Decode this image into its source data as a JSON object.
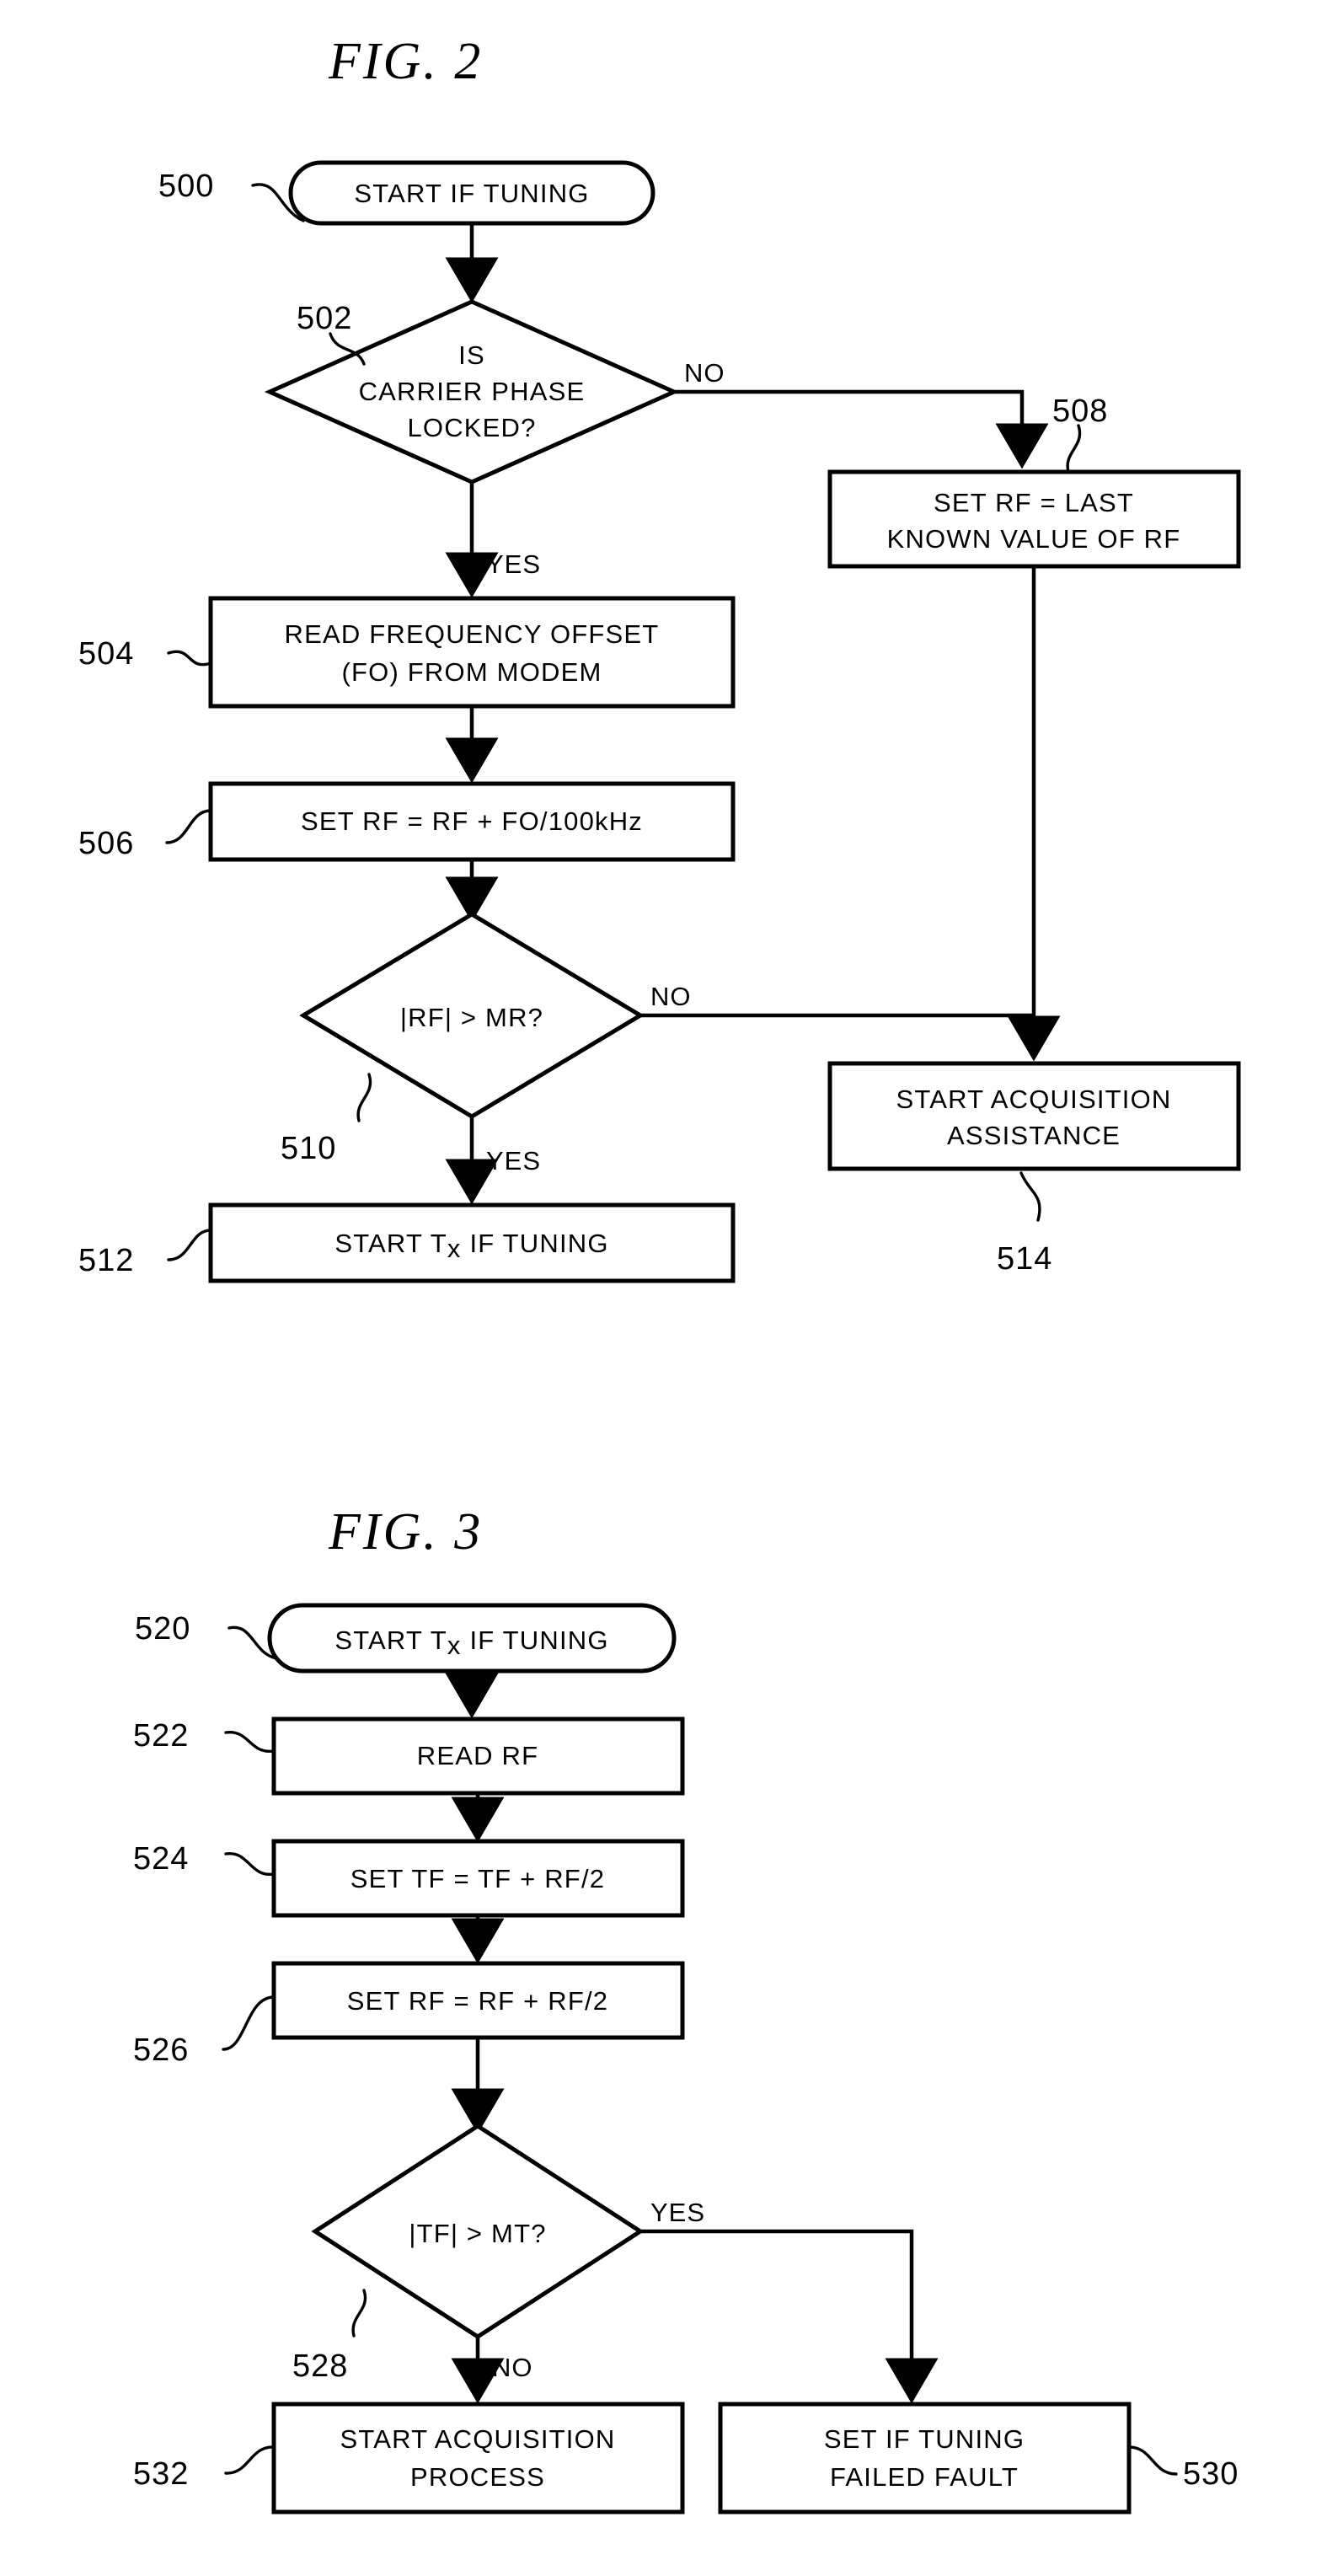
{
  "document": {
    "kind": "patent-flowchart-sheet",
    "ink_color": "#000000",
    "paper_color": "#ffffff"
  },
  "figures": [
    {
      "id": "fig2",
      "title": "FIG.  2",
      "nodes": [
        {
          "ref": "500",
          "shape": "terminator",
          "lines": [
            "START IF TUNING"
          ]
        },
        {
          "ref": "502",
          "shape": "decision",
          "lines": [
            "IS",
            "CARRIER PHASE",
            "LOCKED?"
          ]
        },
        {
          "ref": "504",
          "shape": "process",
          "lines": [
            "READ FREQUENCY OFFSET",
            "(FO) FROM MODEM"
          ]
        },
        {
          "ref": "506",
          "shape": "process",
          "lines": [
            "SET RF = RF + FO/100kHz"
          ]
        },
        {
          "ref": "508",
          "shape": "process",
          "lines": [
            "SET RF = LAST",
            "KNOWN VALUE OF RF"
          ]
        },
        {
          "ref": "510",
          "shape": "decision",
          "lines": [
            "|RF| > MR?"
          ]
        },
        {
          "ref": "512",
          "shape": "process",
          "lines": [
            "START Tx IF TUNING"
          ]
        },
        {
          "ref": "514",
          "shape": "process",
          "lines": [
            "START ACQUISITION",
            "ASSISTANCE"
          ]
        }
      ],
      "branch_labels": {
        "d502_no": "NO",
        "d502_yes": "YES",
        "d510_no": "NO",
        "d510_yes": "YES"
      }
    },
    {
      "id": "fig3",
      "title": "FIG.  3",
      "nodes": [
        {
          "ref": "520",
          "shape": "terminator",
          "lines": [
            "START Tx IF TUNING"
          ]
        },
        {
          "ref": "522",
          "shape": "process",
          "lines": [
            "READ RF"
          ]
        },
        {
          "ref": "524",
          "shape": "process",
          "lines": [
            "SET TF = TF + RF/2"
          ]
        },
        {
          "ref": "526",
          "shape": "process",
          "lines": [
            "SET RF = RF + RF/2"
          ]
        },
        {
          "ref": "528",
          "shape": "decision",
          "lines": [
            "|TF| > MT?"
          ]
        },
        {
          "ref": "530",
          "shape": "process",
          "lines": [
            "SET IF TUNING",
            "FAILED FAULT"
          ]
        },
        {
          "ref": "532",
          "shape": "process",
          "lines": [
            "START ACQUISITION",
            "PROCESS"
          ]
        }
      ],
      "branch_labels": {
        "d528_yes": "YES",
        "d528_no": "NO"
      }
    }
  ],
  "text": {
    "fig2_title": "FIG.  2",
    "fig3_title": "FIG.  3",
    "n500": "START IF TUNING",
    "n502_l1": "IS",
    "n502_l2": "CARRIER PHASE",
    "n502_l3": "LOCKED?",
    "n504_l1": "READ FREQUENCY OFFSET",
    "n504_l2": "(FO) FROM MODEM",
    "n506": "SET RF = RF + FO/100kHz",
    "n508_l1": "SET RF = LAST",
    "n508_l2": "KNOWN VALUE OF RF",
    "n510": "|RF| > MR?",
    "n512_a": "START T",
    "n512_b": "x",
    "n512_c": " IF TUNING",
    "n514_l1": "START ACQUISITION",
    "n514_l2": "ASSISTANCE",
    "n520_a": "START T",
    "n520_b": "x",
    "n520_c": " IF TUNING",
    "n522": "READ RF",
    "n524": "SET TF = TF + RF/2",
    "n526": "SET RF = RF + RF/2",
    "n528": "|TF| > MT?",
    "n530_l1": "SET IF TUNING",
    "n530_l2": "FAILED FAULT",
    "n532_l1": "START ACQUISITION",
    "n532_l2": "PROCESS",
    "r500": "500",
    "r502": "502",
    "r504": "504",
    "r506": "506",
    "r508": "508",
    "r510": "510",
    "r512": "512",
    "r514": "514",
    "r520": "520",
    "r522": "522",
    "r524": "524",
    "r526": "526",
    "r528": "528",
    "r530": "530",
    "r532": "532",
    "yes1": "YES",
    "no1": "NO",
    "yes2": "YES",
    "no2": "NO",
    "yes3": "YES",
    "no3": "NO"
  }
}
